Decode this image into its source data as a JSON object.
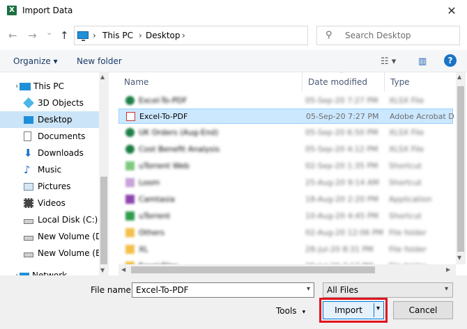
{
  "window": {
    "title": "Import Data",
    "app_icon": "X",
    "close_glyph": "✕"
  },
  "nav": {
    "back_glyph": "←",
    "forward_glyph": "→",
    "recent_glyph": "⌄",
    "up_glyph": "↑"
  },
  "address": {
    "segments": [
      "This PC",
      "Desktop"
    ],
    "chevron": "›",
    "dropdown_glyph": "⌄",
    "refresh_glyph": "↻"
  },
  "search": {
    "placeholder": "Search Desktop",
    "glyph": "⚲"
  },
  "toolbar": {
    "organize": "Organize ▾",
    "new_folder": "New folder",
    "view_glyph": "☷ ▾",
    "pane_glyph": "▥",
    "help": "?"
  },
  "navpane": {
    "items": [
      {
        "label": "This PC",
        "icon": "pc-icon"
      },
      {
        "label": "3D Objects",
        "icon": "cube-icon"
      },
      {
        "label": "Desktop",
        "icon": "desktop-icon"
      },
      {
        "label": "Documents",
        "icon": "document-icon"
      },
      {
        "label": "Downloads",
        "icon": "download-icon"
      },
      {
        "label": "Music",
        "icon": "music-icon"
      },
      {
        "label": "Pictures",
        "icon": "picture-icon"
      },
      {
        "label": "Videos",
        "icon": "video-icon"
      },
      {
        "label": "Local Disk (C:)",
        "icon": "drive-icon"
      },
      {
        "label": "New Volume (D:",
        "icon": "drive-icon"
      },
      {
        "label": "New Volume (E:)",
        "icon": "drive-icon"
      },
      {
        "label": "Network",
        "icon": "network-icon"
      }
    ],
    "expand_glyph": "›"
  },
  "columns": {
    "name": "Name",
    "date": "Date modified",
    "type": "Type",
    "sort_glyph": "⌃"
  },
  "files": [
    {
      "name": "Excel-To-PDF",
      "date": "05-Sep-20 7:27 PM",
      "type": "Adobe Acrobat D",
      "selected": true
    },
    {
      "name": "Excel-To-PDF",
      "date": "05-Sep-20 7:27 PM",
      "type": "Adobe Acrobat D",
      "selected": true
    }
  ],
  "file_types": {
    "excel": "#1d7f45",
    "pdf": "#d32f2f",
    "folder": "#f3c04a",
    "shortcut": "#2e9e4c",
    "app": "#8e44ad"
  },
  "bottom": {
    "file_name_label": "File name:",
    "file_name_value": "Excel-To-PDF",
    "filter_value": "All Files",
    "tools_label": "Tools",
    "import_label": "Import",
    "cancel_label": "Cancel",
    "dd_glyph": "▾"
  }
}
